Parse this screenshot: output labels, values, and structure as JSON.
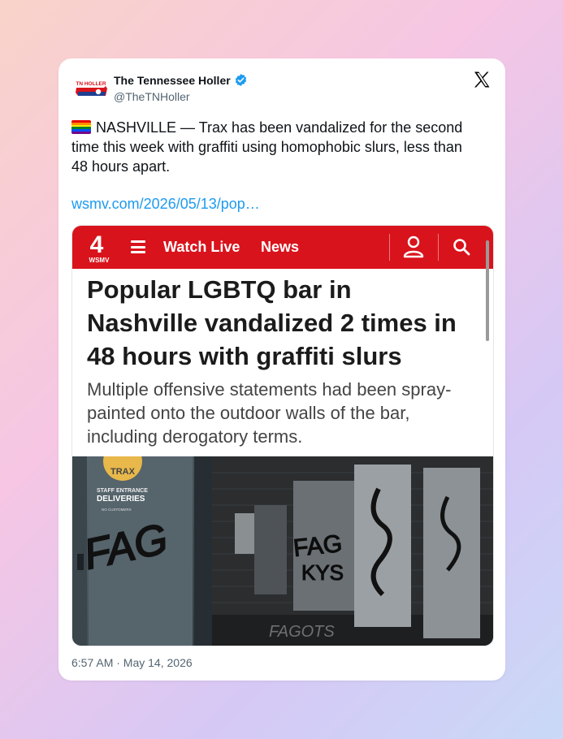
{
  "tweet": {
    "author_name": "The Tennessee Holler",
    "handle": "@TheTNHoller",
    "avatar_text": "TN HOLLER",
    "text": "NASHVILLE — Trax has been vandalized for the second time this week with graffiti using homophobic slurs, less than 48 hours apart.",
    "emoji": "rainbow-flag-icon",
    "link": "wsmv.com/2026/05/13/pop…",
    "timestamp": "6:57 AM · May 14, 2026"
  },
  "preview": {
    "logo_number": "4",
    "logo_text": "WSMV",
    "nav": {
      "watch_live": "Watch Live",
      "news": "News"
    },
    "headline": "Popular LGBTQ bar in Nashville vandalized 2 times in 48 hours with graffiti slurs",
    "subhead": "Multiple offensive statements had been spray-painted onto the outdoor walls of the bar, including derogatory terms.",
    "photo": {
      "door_sign_brand": "TRAX",
      "door_sign_line1": "STAFF ENTRANCE",
      "door_sign_line2": "DELIVERIES",
      "door_sign_line3": "NO CUSTOMERS",
      "graffiti_left": "FAG",
      "graffiti_right_1": "FAG",
      "graffiti_right_2": "KYS",
      "graffiti_right_3": "FAGOTS"
    }
  },
  "colors": {
    "accent_link": "#1d9bf0",
    "wsmv_red": "#d9131c",
    "verified_blue": "#1d9bf0"
  },
  "icons": [
    "x-logo-icon",
    "verified-badge-icon",
    "hamburger-menu-icon",
    "user-icon",
    "search-icon"
  ]
}
